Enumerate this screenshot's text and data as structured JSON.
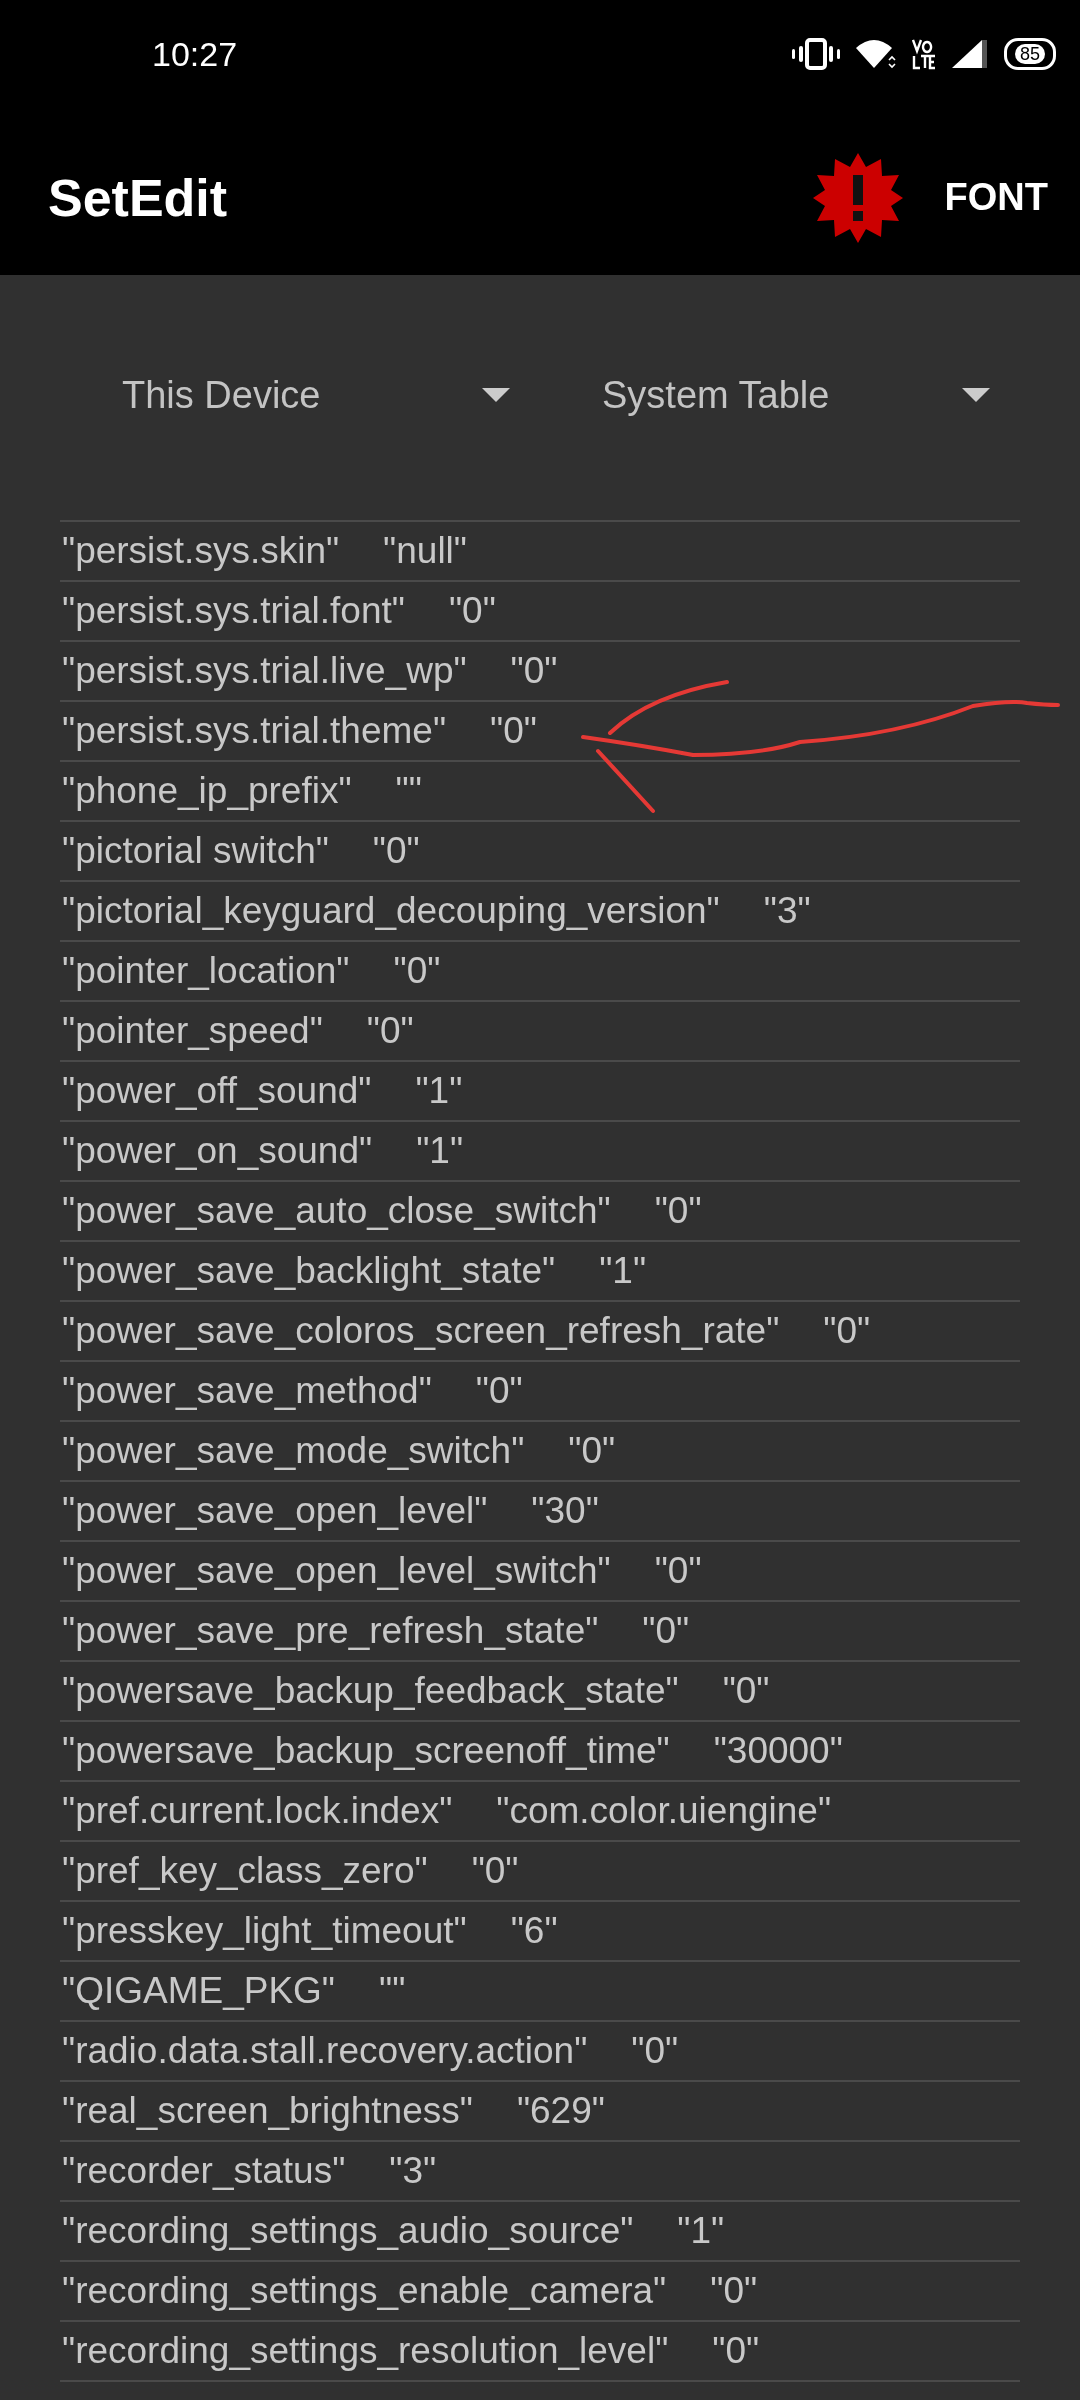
{
  "status_bar": {
    "time": "10:27",
    "battery": "85"
  },
  "app_bar": {
    "title": "SetEdit",
    "action": "FONT"
  },
  "spinners": [
    {
      "label": "This Device"
    },
    {
      "label": "System Table"
    }
  ],
  "rows": [
    {
      "key": "\"persist.sys.skin\"",
      "value": "\"null\""
    },
    {
      "key": "\"persist.sys.trial.font\"",
      "value": "\"0\""
    },
    {
      "key": "\"persist.sys.trial.live_wp\"",
      "value": "\"0\""
    },
    {
      "key": "\"persist.sys.trial.theme\"",
      "value": "\"0\""
    },
    {
      "key": "\"phone_ip_prefix\"",
      "value": "\"\""
    },
    {
      "key": "\"pictorial switch\"",
      "value": "\"0\""
    },
    {
      "key": "\"pictorial_keyguard_decouping_version\"",
      "value": "\"3\""
    },
    {
      "key": "\"pointer_location\"",
      "value": "\"0\""
    },
    {
      "key": "\"pointer_speed\"",
      "value": "\"0\""
    },
    {
      "key": "\"power_off_sound\"",
      "value": "\"1\""
    },
    {
      "key": "\"power_on_sound\"",
      "value": "\"1\""
    },
    {
      "key": "\"power_save_auto_close_switch\"",
      "value": "\"0\""
    },
    {
      "key": "\"power_save_backlight_state\"",
      "value": "\"1\""
    },
    {
      "key": "\"power_save_coloros_screen_refresh_rate\"",
      "value": "\"0\""
    },
    {
      "key": "\"power_save_method\"",
      "value": "\"0\""
    },
    {
      "key": "\"power_save_mode_switch\"",
      "value": "\"0\""
    },
    {
      "key": "\"power_save_open_level\"",
      "value": "\"30\""
    },
    {
      "key": "\"power_save_open_level_switch\"",
      "value": "\"0\""
    },
    {
      "key": "\"power_save_pre_refresh_state\"",
      "value": "\"0\""
    },
    {
      "key": "\"powersave_backup_feedback_state\"",
      "value": "\"0\""
    },
    {
      "key": "\"powersave_backup_screenoff_time\"",
      "value": "\"30000\""
    },
    {
      "key": "\"pref.current.lock.index\"",
      "value": "\"com.color.uiengine\""
    },
    {
      "key": "\"pref_key_class_zero\"",
      "value": "\"0\""
    },
    {
      "key": "\"presskey_light_timeout\"",
      "value": "\"6\""
    },
    {
      "key": "\"QIGAME_PKG\"",
      "value": "\"\""
    },
    {
      "key": "\"radio.data.stall.recovery.action\"",
      "value": "\"0\""
    },
    {
      "key": "\"real_screen_brightness\"",
      "value": "\"629\""
    },
    {
      "key": "\"recorder_status\"",
      "value": "\"3\""
    },
    {
      "key": "\"recording_settings_audio_source\"",
      "value": "\"1\""
    },
    {
      "key": "\"recording_settings_enable_camera\"",
      "value": "\"0\""
    },
    {
      "key": "\"recording_settings_resolution_level\"",
      "value": "\"0\""
    }
  ]
}
